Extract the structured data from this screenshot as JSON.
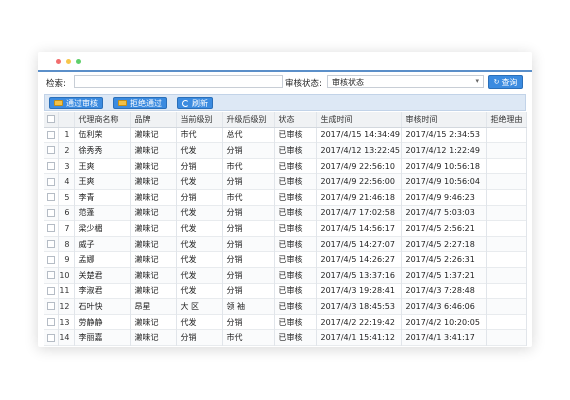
{
  "search": {
    "label": "检索:",
    "value": "",
    "placeholder": ""
  },
  "status_filter": {
    "label": "审核状态:",
    "selected": "审核状态",
    "query_label": "查询"
  },
  "toolbar": {
    "approve_label": "通过审核",
    "reject_label": "拒绝通过",
    "refresh_label": "刷新"
  },
  "table": {
    "headers": [
      "代理商名称",
      "品牌",
      "当前级别",
      "升级后级别",
      "状态",
      "生成时间",
      "审核时间",
      "拒绝理由"
    ],
    "rows": [
      {
        "no": "1",
        "name": "伍利荣",
        "brand": "濑味记",
        "cur": "市代",
        "up": "总代",
        "status": "已审核",
        "created": "2017/4/15 14:34:49",
        "reviewed": "2017/4/15 2:34:53",
        "reason": ""
      },
      {
        "no": "2",
        "name": "徐秀秀",
        "brand": "濑味记",
        "cur": "代发",
        "up": "分销",
        "status": "已审核",
        "created": "2017/4/12 13:22:45",
        "reviewed": "2017/4/12 1:22:49",
        "reason": ""
      },
      {
        "no": "3",
        "name": "王爽",
        "brand": "濑味记",
        "cur": "分销",
        "up": "市代",
        "status": "已审核",
        "created": "2017/4/9 22:56:10",
        "reviewed": "2017/4/9 10:56:18",
        "reason": ""
      },
      {
        "no": "4",
        "name": "王爽",
        "brand": "濑味记",
        "cur": "代发",
        "up": "分销",
        "status": "已审核",
        "created": "2017/4/9 22:56:00",
        "reviewed": "2017/4/9 10:56:04",
        "reason": ""
      },
      {
        "no": "5",
        "name": "李青",
        "brand": "濑味记",
        "cur": "分销",
        "up": "市代",
        "status": "已审核",
        "created": "2017/4/9 21:46:18",
        "reviewed": "2017/4/9 9:46:23",
        "reason": ""
      },
      {
        "no": "6",
        "name": "范蓬",
        "brand": "濑味记",
        "cur": "代发",
        "up": "分销",
        "status": "已审核",
        "created": "2017/4/7 17:02:58",
        "reviewed": "2017/4/7 5:03:03",
        "reason": ""
      },
      {
        "no": "7",
        "name": "梁少楣",
        "brand": "濑味记",
        "cur": "代发",
        "up": "分销",
        "status": "已审核",
        "created": "2017/4/5 14:56:17",
        "reviewed": "2017/4/5 2:56:21",
        "reason": ""
      },
      {
        "no": "8",
        "name": "威子",
        "brand": "濑味记",
        "cur": "代发",
        "up": "分销",
        "status": "已审核",
        "created": "2017/4/5 14:27:07",
        "reviewed": "2017/4/5 2:27:18",
        "reason": ""
      },
      {
        "no": "9",
        "name": "孟娜",
        "brand": "濑味记",
        "cur": "代发",
        "up": "分销",
        "status": "已审核",
        "created": "2017/4/5 14:26:27",
        "reviewed": "2017/4/5 2:26:31",
        "reason": ""
      },
      {
        "no": "10",
        "name": "关楚君",
        "brand": "濑味记",
        "cur": "代发",
        "up": "分销",
        "status": "已审核",
        "created": "2017/4/5 13:37:16",
        "reviewed": "2017/4/5 1:37:21",
        "reason": ""
      },
      {
        "no": "11",
        "name": "李淑君",
        "brand": "濑味记",
        "cur": "代发",
        "up": "分销",
        "status": "已审核",
        "created": "2017/4/3 19:28:41",
        "reviewed": "2017/4/3 7:28:48",
        "reason": ""
      },
      {
        "no": "12",
        "name": "石叶快",
        "brand": "昂星",
        "cur": "大 区",
        "up": "领 袖",
        "status": "已审核",
        "created": "2017/4/3 18:45:53",
        "reviewed": "2017/4/3 6:46:06",
        "reason": ""
      },
      {
        "no": "13",
        "name": "劳静静",
        "brand": "濑味记",
        "cur": "代发",
        "up": "分销",
        "status": "已审核",
        "created": "2017/4/2 22:19:42",
        "reviewed": "2017/4/2 10:20:05",
        "reason": ""
      },
      {
        "no": "14",
        "name": "李丽嘉",
        "brand": "濑味记",
        "cur": "分销",
        "up": "市代",
        "status": "已审核",
        "created": "2017/4/1 15:41:12",
        "reviewed": "2017/4/1 3:41:17",
        "reason": ""
      }
    ]
  },
  "colors": {
    "accent": "#3b8be0",
    "toolbar_bg": "#dde8f5",
    "window_dot_red": "#f26d6d",
    "window_dot_yellow": "#f7c64b",
    "window_dot_green": "#5fcf6b"
  }
}
